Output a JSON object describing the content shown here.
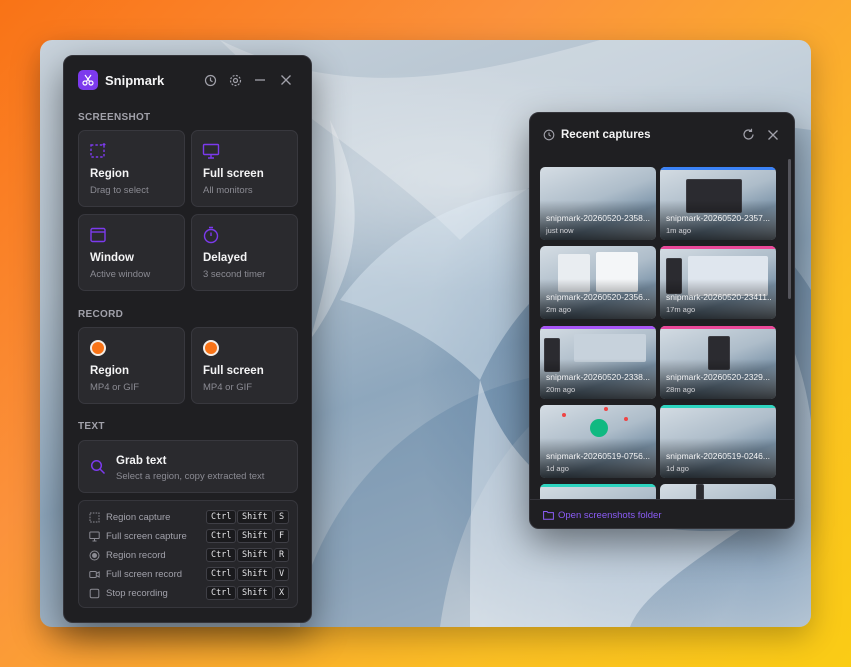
{
  "app": {
    "name": "Snipmark",
    "accent": "#7c3aed",
    "record_color": "#f97316",
    "icons": [
      "scissors-icon",
      "history-icon",
      "gear-icon",
      "minimize-icon",
      "close-icon"
    ]
  },
  "sections": {
    "screenshot": "SCREENSHOT",
    "record": "RECORD",
    "text": "TEXT"
  },
  "screenshot_tiles": [
    {
      "title": "Region",
      "subtitle": "Drag to select",
      "icon": "region-select-icon"
    },
    {
      "title": "Full screen",
      "subtitle": "All monitors",
      "icon": "monitor-icon"
    },
    {
      "title": "Window",
      "subtitle": "Active window",
      "icon": "window-icon"
    },
    {
      "title": "Delayed",
      "subtitle": "3 second timer",
      "icon": "timer-icon"
    }
  ],
  "record_tiles": [
    {
      "title": "Region",
      "subtitle": "MP4 or GIF",
      "icon": "record-dot-icon"
    },
    {
      "title": "Full screen",
      "subtitle": "MP4 or GIF",
      "icon": "record-dot-icon"
    }
  ],
  "grab_text": {
    "title": "Grab text",
    "subtitle": "Select a region, copy extracted text",
    "icon": "search-icon"
  },
  "shortcuts": [
    {
      "label": "Region capture",
      "keys": [
        "Ctrl",
        "Shift",
        "S"
      ],
      "icon": "region-select-icon"
    },
    {
      "label": "Full screen capture",
      "keys": [
        "Ctrl",
        "Shift",
        "F"
      ],
      "icon": "monitor-icon"
    },
    {
      "label": "Region record",
      "keys": [
        "Ctrl",
        "Shift",
        "R"
      ],
      "icon": "record-dot-icon"
    },
    {
      "label": "Full screen record",
      "keys": [
        "Ctrl",
        "Shift",
        "V"
      ],
      "icon": "video-icon"
    },
    {
      "label": "Stop recording",
      "keys": [
        "Ctrl",
        "Shift",
        "X"
      ],
      "icon": "stop-icon"
    }
  ],
  "recent": {
    "title": "Recent captures",
    "icons": [
      "clock-icon",
      "refresh-icon",
      "close-icon"
    ],
    "footer_link": "Open screenshots folder",
    "items": [
      {
        "name": "snipmark-20260520-2358...",
        "ago": "just now",
        "accent": ""
      },
      {
        "name": "snipmark-20260520-2357...",
        "ago": "1m ago",
        "accent": "#3b82f6"
      },
      {
        "name": "snipmark-20260520-2356...",
        "ago": "2m ago",
        "accent": ""
      },
      {
        "name": "snipmark-20260520-23411...",
        "ago": "17m ago",
        "accent": "#ec4899"
      },
      {
        "name": "snipmark-20260520-2338...",
        "ago": "20m ago",
        "accent": "#a855f7"
      },
      {
        "name": "snipmark-20260520-2329...",
        "ago": "28m ago",
        "accent": "#ec4899"
      },
      {
        "name": "snipmark-20260519-0756...",
        "ago": "1d ago",
        "accent": ""
      },
      {
        "name": "snipmark-20260519-0246...",
        "ago": "1d ago",
        "accent": "#2dd4bf"
      },
      {
        "name": "",
        "ago": "",
        "accent": "#2dd4bf"
      },
      {
        "name": "",
        "ago": "",
        "accent": ""
      }
    ]
  }
}
